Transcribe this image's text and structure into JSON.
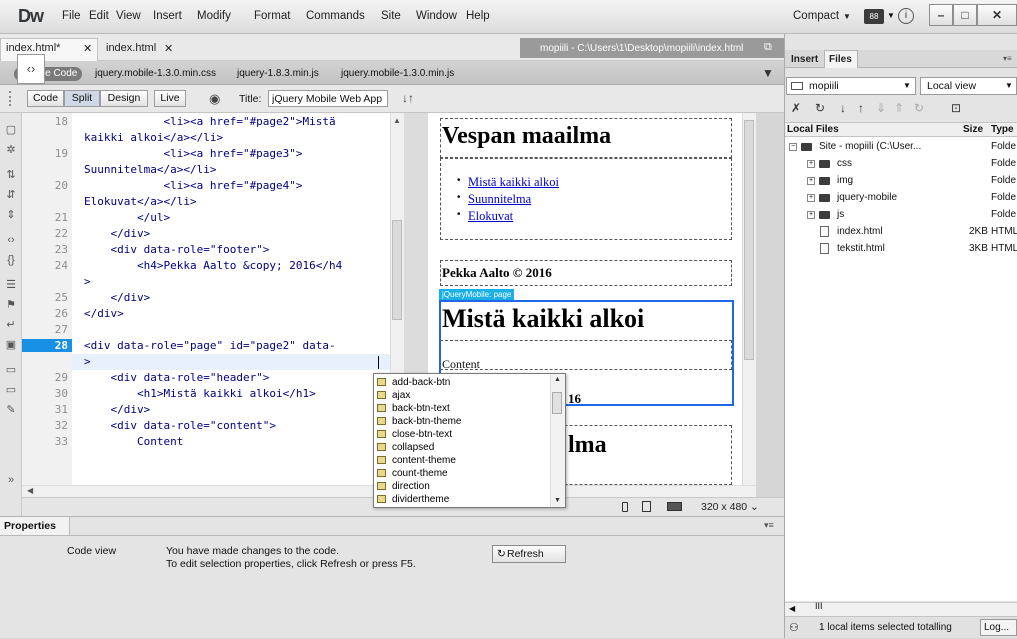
{
  "app": {
    "logo": "Dw",
    "menus": [
      "File",
      "Edit",
      "View",
      "Insert",
      "Modify",
      "Format",
      "Commands",
      "Site",
      "Window",
      "Help"
    ],
    "workspace": "Compact",
    "extension_label": "88"
  },
  "doc_tabs": [
    {
      "label": "index.html*",
      "active": true
    },
    {
      "label": "index.html",
      "active": false
    }
  ],
  "site_path": "mopiili - C:\\Users\\1\\Desktop\\mopiili\\index.html",
  "related_files": {
    "source_label": "Source Code",
    "files": [
      "jquery.mobile-1.3.0.min.css",
      "jquery-1.8.3.min.js",
      "jquery.mobile-1.3.0.min.js"
    ]
  },
  "view_bar": {
    "code": "Code",
    "split": "Split",
    "design": "Design",
    "live": "Live",
    "title_label": "Title:",
    "title_value": "jQuery Mobile Web App"
  },
  "code_lines": [
    {
      "n": "18",
      "text": "            <li><a href=\"#page2\">Mistä"
    },
    {
      "n": "",
      "text": "kaikki alkoi</a></li>"
    },
    {
      "n": "19",
      "text": "            <li><a href=\"#page3\">"
    },
    {
      "n": "",
      "text": "Suunnitelma</a></li>"
    },
    {
      "n": "20",
      "text": "            <li><a href=\"#page4\">"
    },
    {
      "n": "",
      "text": "Elokuvat</a></li>"
    },
    {
      "n": "21",
      "text": "        </ul>"
    },
    {
      "n": "22",
      "text": "    </div>"
    },
    {
      "n": "23",
      "text": "    <div data-role=\"footer\">"
    },
    {
      "n": "24",
      "text": "        <h4>Pekka Aalto &copy; 2016</h4"
    },
    {
      "n": "",
      "text": ">"
    },
    {
      "n": "25",
      "text": "    </div>"
    },
    {
      "n": "26",
      "text": "</div>"
    },
    {
      "n": "27",
      "text": ""
    },
    {
      "n": "28",
      "text": "<div data-role=\"page\" id=\"page2\" data-"
    },
    {
      "n": "",
      "text": ">"
    },
    {
      "n": "29",
      "text": "    <div data-role=\"header\">"
    },
    {
      "n": "30",
      "text": "        <h1>Mistä kaikki alkoi</h1>"
    },
    {
      "n": "31",
      "text": "    </div>"
    },
    {
      "n": "32",
      "text": "    <div data-role=\"content\">"
    },
    {
      "n": "33",
      "text": "        Content"
    }
  ],
  "design": {
    "page1_title": "Vespan maailma",
    "nav_links": [
      "Mistä kaikki alkoi",
      "Suunnitelma",
      "Elokuvat"
    ],
    "footer": "Pekka Aalto © 2016",
    "jq_tag": "jQueryMobile: page",
    "page2_title": "Mistä kaikki alkoi",
    "page2_content": "Content",
    "page2_footer_partial": "16",
    "page3_title_partial": "lma"
  },
  "code_hints": [
    "add-back-btn",
    "ajax",
    "back-btn-text",
    "back-btn-theme",
    "close-btn-text",
    "collapsed",
    "content-theme",
    "count-theme",
    "direction",
    "dividertheme"
  ],
  "device_size": "320 x 480",
  "properties": {
    "tab": "Properties",
    "mode": "Code view",
    "message1": "You have made changes to the code.",
    "message2": "To edit selection properties, click Refresh or press F5.",
    "refresh": "Refresh"
  },
  "files_panel": {
    "tabs": [
      "Insert",
      "Files"
    ],
    "site": "mopiili",
    "view": "Local view",
    "col_local": "Local Files",
    "col_size": "Size",
    "col_type": "Type",
    "rows": [
      {
        "name": "Site - mopiili (C:\\User...",
        "size": "",
        "type": "Folde",
        "kind": "site",
        "indent": 0
      },
      {
        "name": "css",
        "size": "",
        "type": "Folde",
        "kind": "folder",
        "indent": 1
      },
      {
        "name": "img",
        "size": "",
        "type": "Folde",
        "kind": "folder",
        "indent": 1
      },
      {
        "name": "jquery-mobile",
        "size": "",
        "type": "Folde",
        "kind": "folder",
        "indent": 1
      },
      {
        "name": "js",
        "size": "",
        "type": "Folde",
        "kind": "folder",
        "indent": 1
      },
      {
        "name": "index.html",
        "size": "2KB",
        "type": "HTML",
        "kind": "file",
        "indent": 1
      },
      {
        "name": "tekstit.html",
        "size": "3KB",
        "type": "HTML",
        "kind": "file",
        "indent": 1
      }
    ],
    "status": "1 local items selected totalling",
    "log": "Log..."
  }
}
